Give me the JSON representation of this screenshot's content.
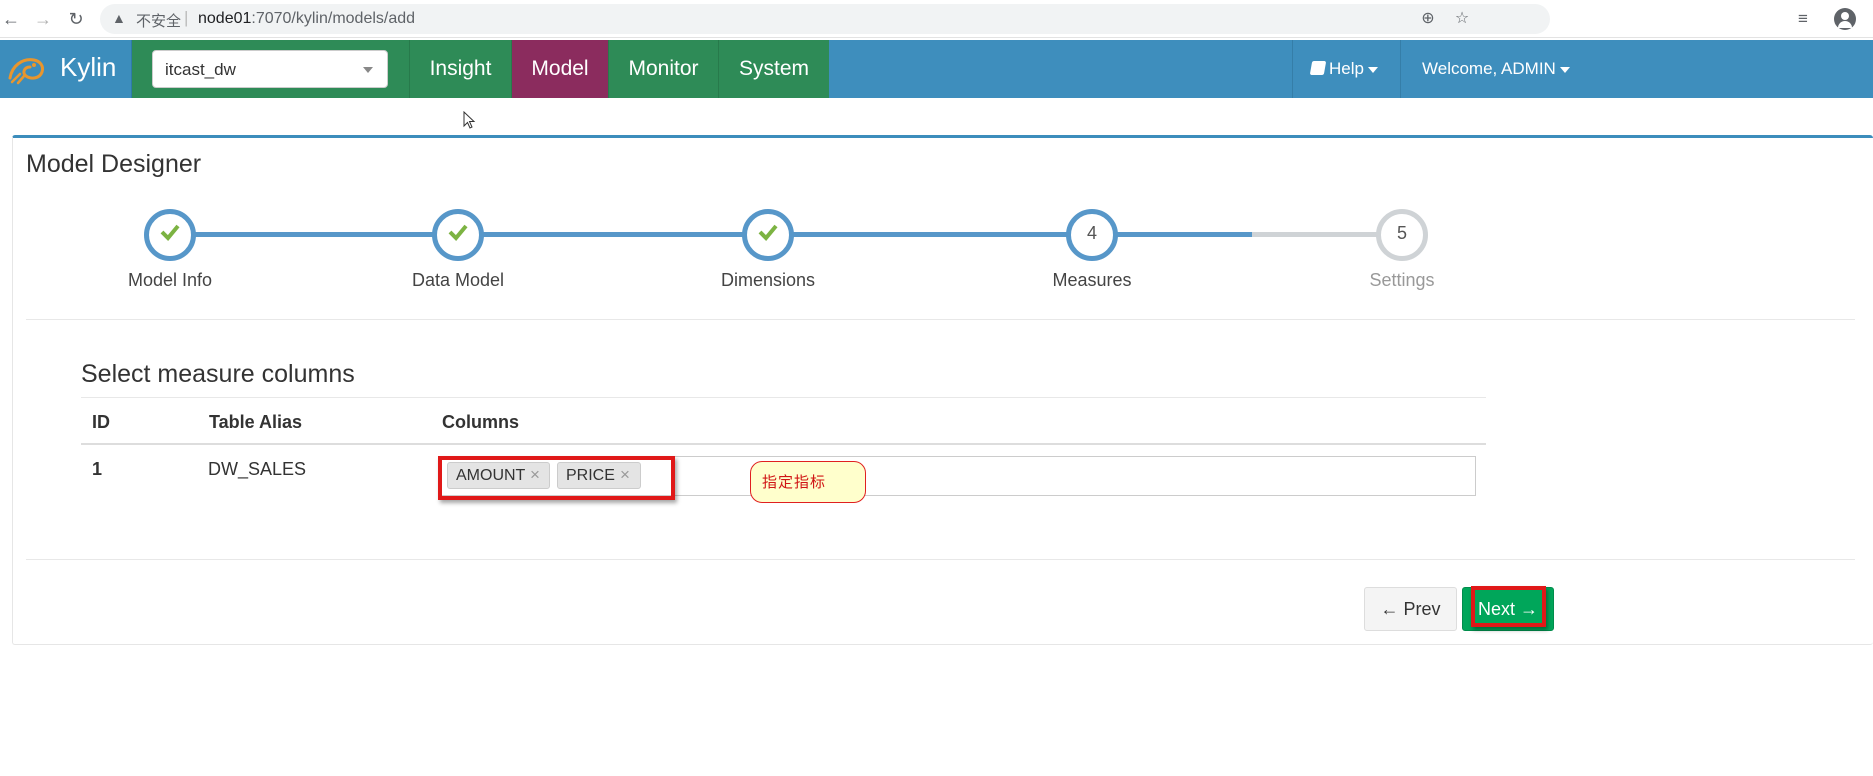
{
  "browser": {
    "insecure_label": "不安全",
    "url_host": "node01",
    "url_path": ":7070/kylin/models/add"
  },
  "navbar": {
    "brand": "Kylin",
    "project": "itcast_dw",
    "menu": [
      "Insight",
      "Model",
      "Monitor",
      "System"
    ],
    "active": "Model",
    "help_label": "Help",
    "welcome_label": "Welcome, ADMIN"
  },
  "designer": {
    "title": "Model Designer",
    "steps": [
      {
        "label": "Model Info",
        "status": "done"
      },
      {
        "label": "Data Model",
        "status": "done"
      },
      {
        "label": "Dimensions",
        "status": "done"
      },
      {
        "label": "Measures",
        "number": "4",
        "status": "current"
      },
      {
        "label": "Settings",
        "number": "5",
        "status": "pending"
      }
    ]
  },
  "measures": {
    "section_title": "Select measure columns",
    "headers": {
      "id": "ID",
      "alias": "Table Alias",
      "columns": "Columns"
    },
    "rows": [
      {
        "id": "1",
        "alias": "DW_SALES",
        "columns": [
          "AMOUNT",
          "PRICE"
        ]
      }
    ],
    "remove_glyph": "×"
  },
  "annotation": {
    "text": "指定指标"
  },
  "buttons": {
    "prev": "Prev",
    "next": "Next"
  },
  "colors": {
    "accent": "#3c8dbc",
    "nav_green": "#2e8b57",
    "active": "#8b2c5e",
    "next": "#00a65a",
    "highlight": "#e01818"
  }
}
